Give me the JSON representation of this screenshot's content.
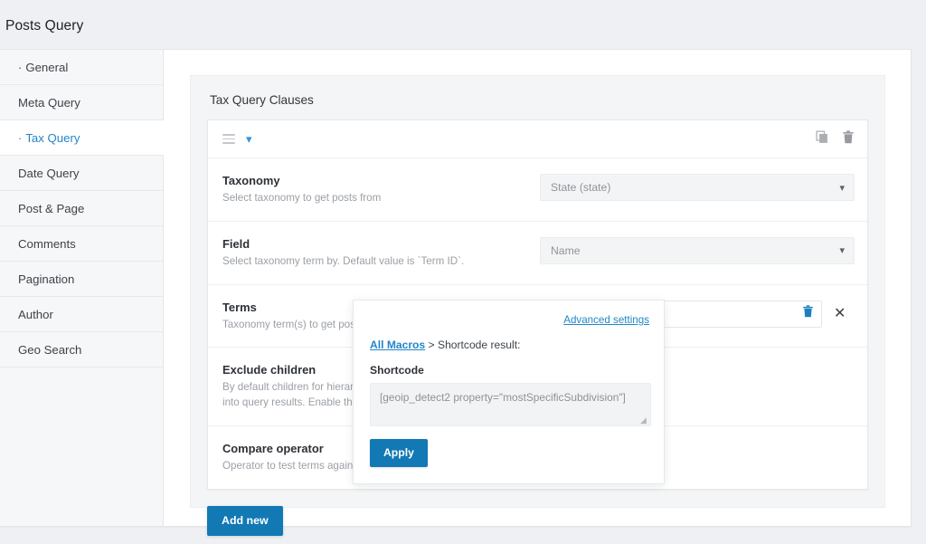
{
  "page": {
    "title": "Posts Query"
  },
  "sidebar": {
    "items": [
      {
        "label": "General",
        "bullet": "·",
        "active": false
      },
      {
        "label": "Meta Query",
        "bullet": "",
        "active": false
      },
      {
        "label": "Tax Query",
        "bullet": "·",
        "active": true
      },
      {
        "label": "Date Query",
        "bullet": "",
        "active": false
      },
      {
        "label": "Post & Page",
        "bullet": "",
        "active": false
      },
      {
        "label": "Comments",
        "bullet": "",
        "active": false
      },
      {
        "label": "Pagination",
        "bullet": "",
        "active": false
      },
      {
        "label": "Author",
        "bullet": "",
        "active": false
      },
      {
        "label": "Geo Search",
        "bullet": "",
        "active": false
      }
    ]
  },
  "panel": {
    "title": "Tax Query Clauses",
    "clause_header": {
      "drag_handle_icon": "drag-handle-icon",
      "collapse_icon": "chevron-down-icon",
      "duplicate_icon": "copy-icon",
      "delete_icon": "trash-icon"
    },
    "rows": [
      {
        "label": "Taxonomy",
        "desc": "Select taxonomy to get posts from",
        "control": "select",
        "value": "State (state)"
      },
      {
        "label": "Field",
        "desc": "Select taxonomy term by. Default value is `Term ID`.",
        "control": "select",
        "value": "Name"
      },
      {
        "label": "Terms",
        "desc": "Taxonomy term(s) to get posts by.",
        "control": "macro-field",
        "placeholder": "Shortcode result",
        "value": ""
      },
      {
        "label": "Exclude children",
        "desc": "By default children for hierarchical taxonomies will be included into query results. Enable this option to exclude children terms.",
        "control": "none",
        "value": ""
      },
      {
        "label": "Compare operator",
        "desc": "Operator to test terms against.",
        "control": "none",
        "value": ""
      }
    ],
    "add_new_label": "Add new"
  },
  "popover": {
    "advanced_settings_label": "Advanced settings",
    "breadcrumb_link": "All Macros",
    "breadcrumb_separator": ">",
    "breadcrumb_current": "Shortcode result:",
    "shortcode_label": "Shortcode",
    "shortcode_value": "[geoip_detect2 property=\"mostSpecificSubdivision\"]",
    "apply_label": "Apply"
  },
  "colors": {
    "accent_blue": "#1279b5",
    "link_blue": "#2386c8",
    "page_bg": "#eef0f3",
    "panel_bg": "#f4f5f6",
    "sidebar_bg": "#f6f7f8"
  }
}
